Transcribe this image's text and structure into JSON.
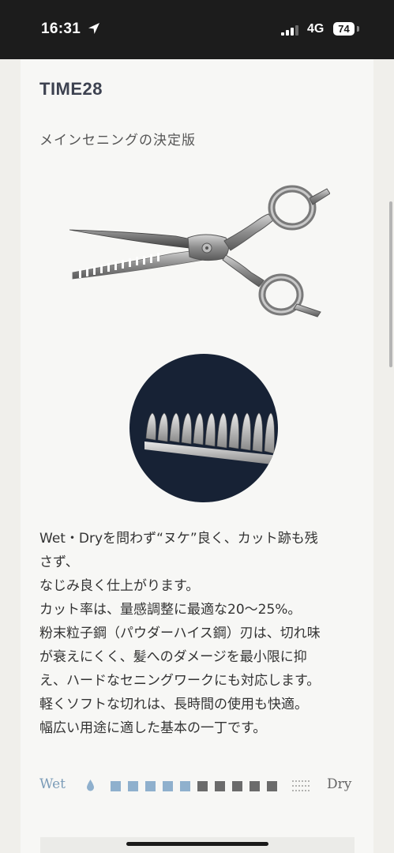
{
  "status_bar": {
    "time": "16:31",
    "network": "4G",
    "battery": "74"
  },
  "product": {
    "title": "TIME28",
    "subtitle": "メインセニングの決定版",
    "description_lines": [
      "Wet・Dryを問わず“ヌケ”良く、カット跡も残",
      "さず、",
      "なじみ良く仕上がります。",
      "カット率は、量感調整に最適な20〜25%。",
      "粉末粒子鋼（パウダーハイス鋼）刃は、切れ味",
      "が衰えにくく、髪へのダメージを最小限に抑",
      "え、ハードなセニングワークにも対応します。",
      "軽くソフトな切れは、長時間の使用も快適。",
      "幅広い用途に適した基本の一丁です。"
    ]
  },
  "wet_dry_scale": {
    "wet_label": "Wet",
    "dry_label": "Dry",
    "wet_level": 5,
    "total_steps": 10,
    "wet_color": "#8fb0cd",
    "dry_color": "#6b6b6b",
    "wet_icon": "water-drop-icon",
    "dry_icon": "dry-wind-icon"
  }
}
